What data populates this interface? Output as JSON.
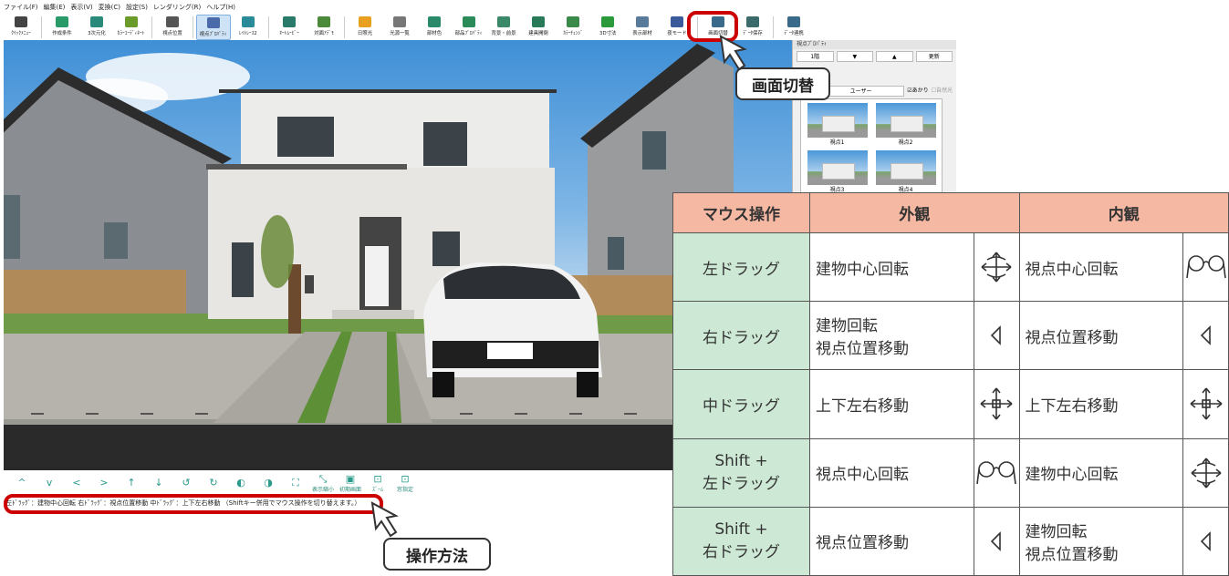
{
  "menubar": [
    "ファイル(F)",
    "編集(E)",
    "表示(V)",
    "変換(C)",
    "設定(S)",
    "レンダリング(R)",
    "ヘルプ(H)"
  ],
  "toolbar": [
    {
      "label": "ｸｲｯｸﾒﾆｭｰ",
      "icon": "menu-icon",
      "color": "#444444"
    },
    {
      "label": "作成条件",
      "icon": "settings-icon",
      "color": "#2a9a6a"
    },
    {
      "label": "3次元化",
      "icon": "cube-icon",
      "color": "#2a8a7a"
    },
    {
      "label": "ｶﾗｰｺｰﾃﾞｨﾈｰﾄ",
      "icon": "palette-icon",
      "color": "#6a9a2a"
    },
    {
      "label": "視点位置",
      "icon": "camera-icon",
      "color": "#555555"
    },
    {
      "label": "視点ﾌﾟﾛﾊﾟﾃｨ",
      "icon": "camera-property-icon",
      "color": "#4a6aaa",
      "active": true
    },
    {
      "label": "ﾚｲﾄﾚｰｽ2",
      "icon": "raytrace-icon",
      "color": "#2a8a9a"
    },
    {
      "label": "ｵｰﾄﾑｰﾋﾞｰ",
      "icon": "movie-icon",
      "color": "#2a7a6a"
    },
    {
      "label": "対面ｱﾃﾞﾓ",
      "icon": "demo-icon",
      "color": "#4a8a3a"
    },
    {
      "label": "日照光",
      "icon": "sun-icon",
      "color": "#e8a020"
    },
    {
      "label": "光源一覧",
      "icon": "light-list-icon",
      "color": "#777777"
    },
    {
      "label": "部材色",
      "icon": "material-color-icon",
      "color": "#2a8a6a"
    },
    {
      "label": "部品ﾌﾟﾛﾊﾟﾃｨ",
      "icon": "part-property-icon",
      "color": "#2a8a5a"
    },
    {
      "label": "背景・前景",
      "icon": "background-icon",
      "color": "#3a8a6a"
    },
    {
      "label": "建具開閉",
      "icon": "door-icon",
      "color": "#2a7a5a"
    },
    {
      "label": "ｶﾗｰﾁｪﾝｼﾞ",
      "icon": "color-change-icon",
      "color": "#3a8a4a"
    },
    {
      "label": "3D寸法",
      "icon": "dimension-3d-icon",
      "color": "#2a9a3a"
    },
    {
      "label": "表示部材",
      "icon": "display-material-icon",
      "color": "#5a7a9a"
    },
    {
      "label": "夜モード",
      "icon": "night-mode-icon",
      "color": "#3a5a9a"
    },
    {
      "label": "画面切替",
      "icon": "screen-switch-icon",
      "color": "#3a6a8a"
    },
    {
      "label": "ﾃﾞｰﾀ保存",
      "icon": "data-save-icon",
      "color": "#3a6a6a"
    },
    {
      "label": "ﾃﾞｰﾀ連携",
      "icon": "data-link-icon",
      "color": "#3a6a8a"
    }
  ],
  "panel": {
    "title": "視点ﾌﾟﾛﾊﾟﾃｨ",
    "floor": "1階",
    "refresh": "更新",
    "user_tab": "ユーザー",
    "check_on": "あかり",
    "check_sun": "自然光",
    "thumbs": [
      "視点1",
      "視点2",
      "視点3",
      "視点4"
    ]
  },
  "bottombar": [
    {
      "g": "^",
      "label": ""
    },
    {
      "g": "v",
      "label": ""
    },
    {
      "g": "<",
      "label": ""
    },
    {
      "g": ">",
      "label": ""
    },
    {
      "g": "↑",
      "label": ""
    },
    {
      "g": "↓",
      "label": ""
    },
    {
      "g": "↺",
      "label": ""
    },
    {
      "g": "↻",
      "label": ""
    },
    {
      "g": "◐",
      "label": ""
    },
    {
      "g": "◑",
      "label": ""
    },
    {
      "g": "⛶",
      "label": ""
    },
    {
      "g": "⤡",
      "label": "表示縮小"
    },
    {
      "g": "▣",
      "label": "初期画面"
    },
    {
      "g": "⊡",
      "label": "ｽﾞｰﾑ"
    },
    {
      "g": "⊡",
      "label": "窓指定"
    }
  ],
  "status_text": "左ﾄﾞﾗｯｸﾞ：建物中心回転  右ﾄﾞﾗｯｸﾞ：視点位置移動  中ﾄﾞﾗｯｸﾞ：上下左右移動  （Shiftキー併用でマウス操作を切り替えます。）",
  "callouts": {
    "screen_switch": "画面切替",
    "operation": "操作方法"
  },
  "table": {
    "headers": [
      "マウス操作",
      "外観",
      "内観"
    ],
    "rows": [
      {
        "op": "左ドラッグ",
        "ext": "建物中心回転",
        "ext_icon": "rotate-arrows",
        "int": "視点中心回転",
        "int_icon": "eyeglasses"
      },
      {
        "op": "右ドラッグ",
        "ext": "建物回転\n視点位置移動",
        "ext_icon": "cursor",
        "int": "視点位置移動",
        "int_icon": "cursor"
      },
      {
        "op": "中ドラッグ",
        "ext": "上下左右移動",
        "ext_icon": "move-cross",
        "int": "上下左右移動",
        "int_icon": "move-cross"
      },
      {
        "op": "Shift +\n左ドラッグ",
        "ext": "視点中心回転",
        "ext_icon": "eyeglasses",
        "int": "建物中心回転",
        "int_icon": "rotate-arrows"
      },
      {
        "op": "Shift +\n右ドラッグ",
        "ext": "視点位置移動",
        "ext_icon": "cursor",
        "int": "建物回転\n視点位置移動",
        "int_icon": "cursor"
      }
    ]
  },
  "car_plate": ""
}
